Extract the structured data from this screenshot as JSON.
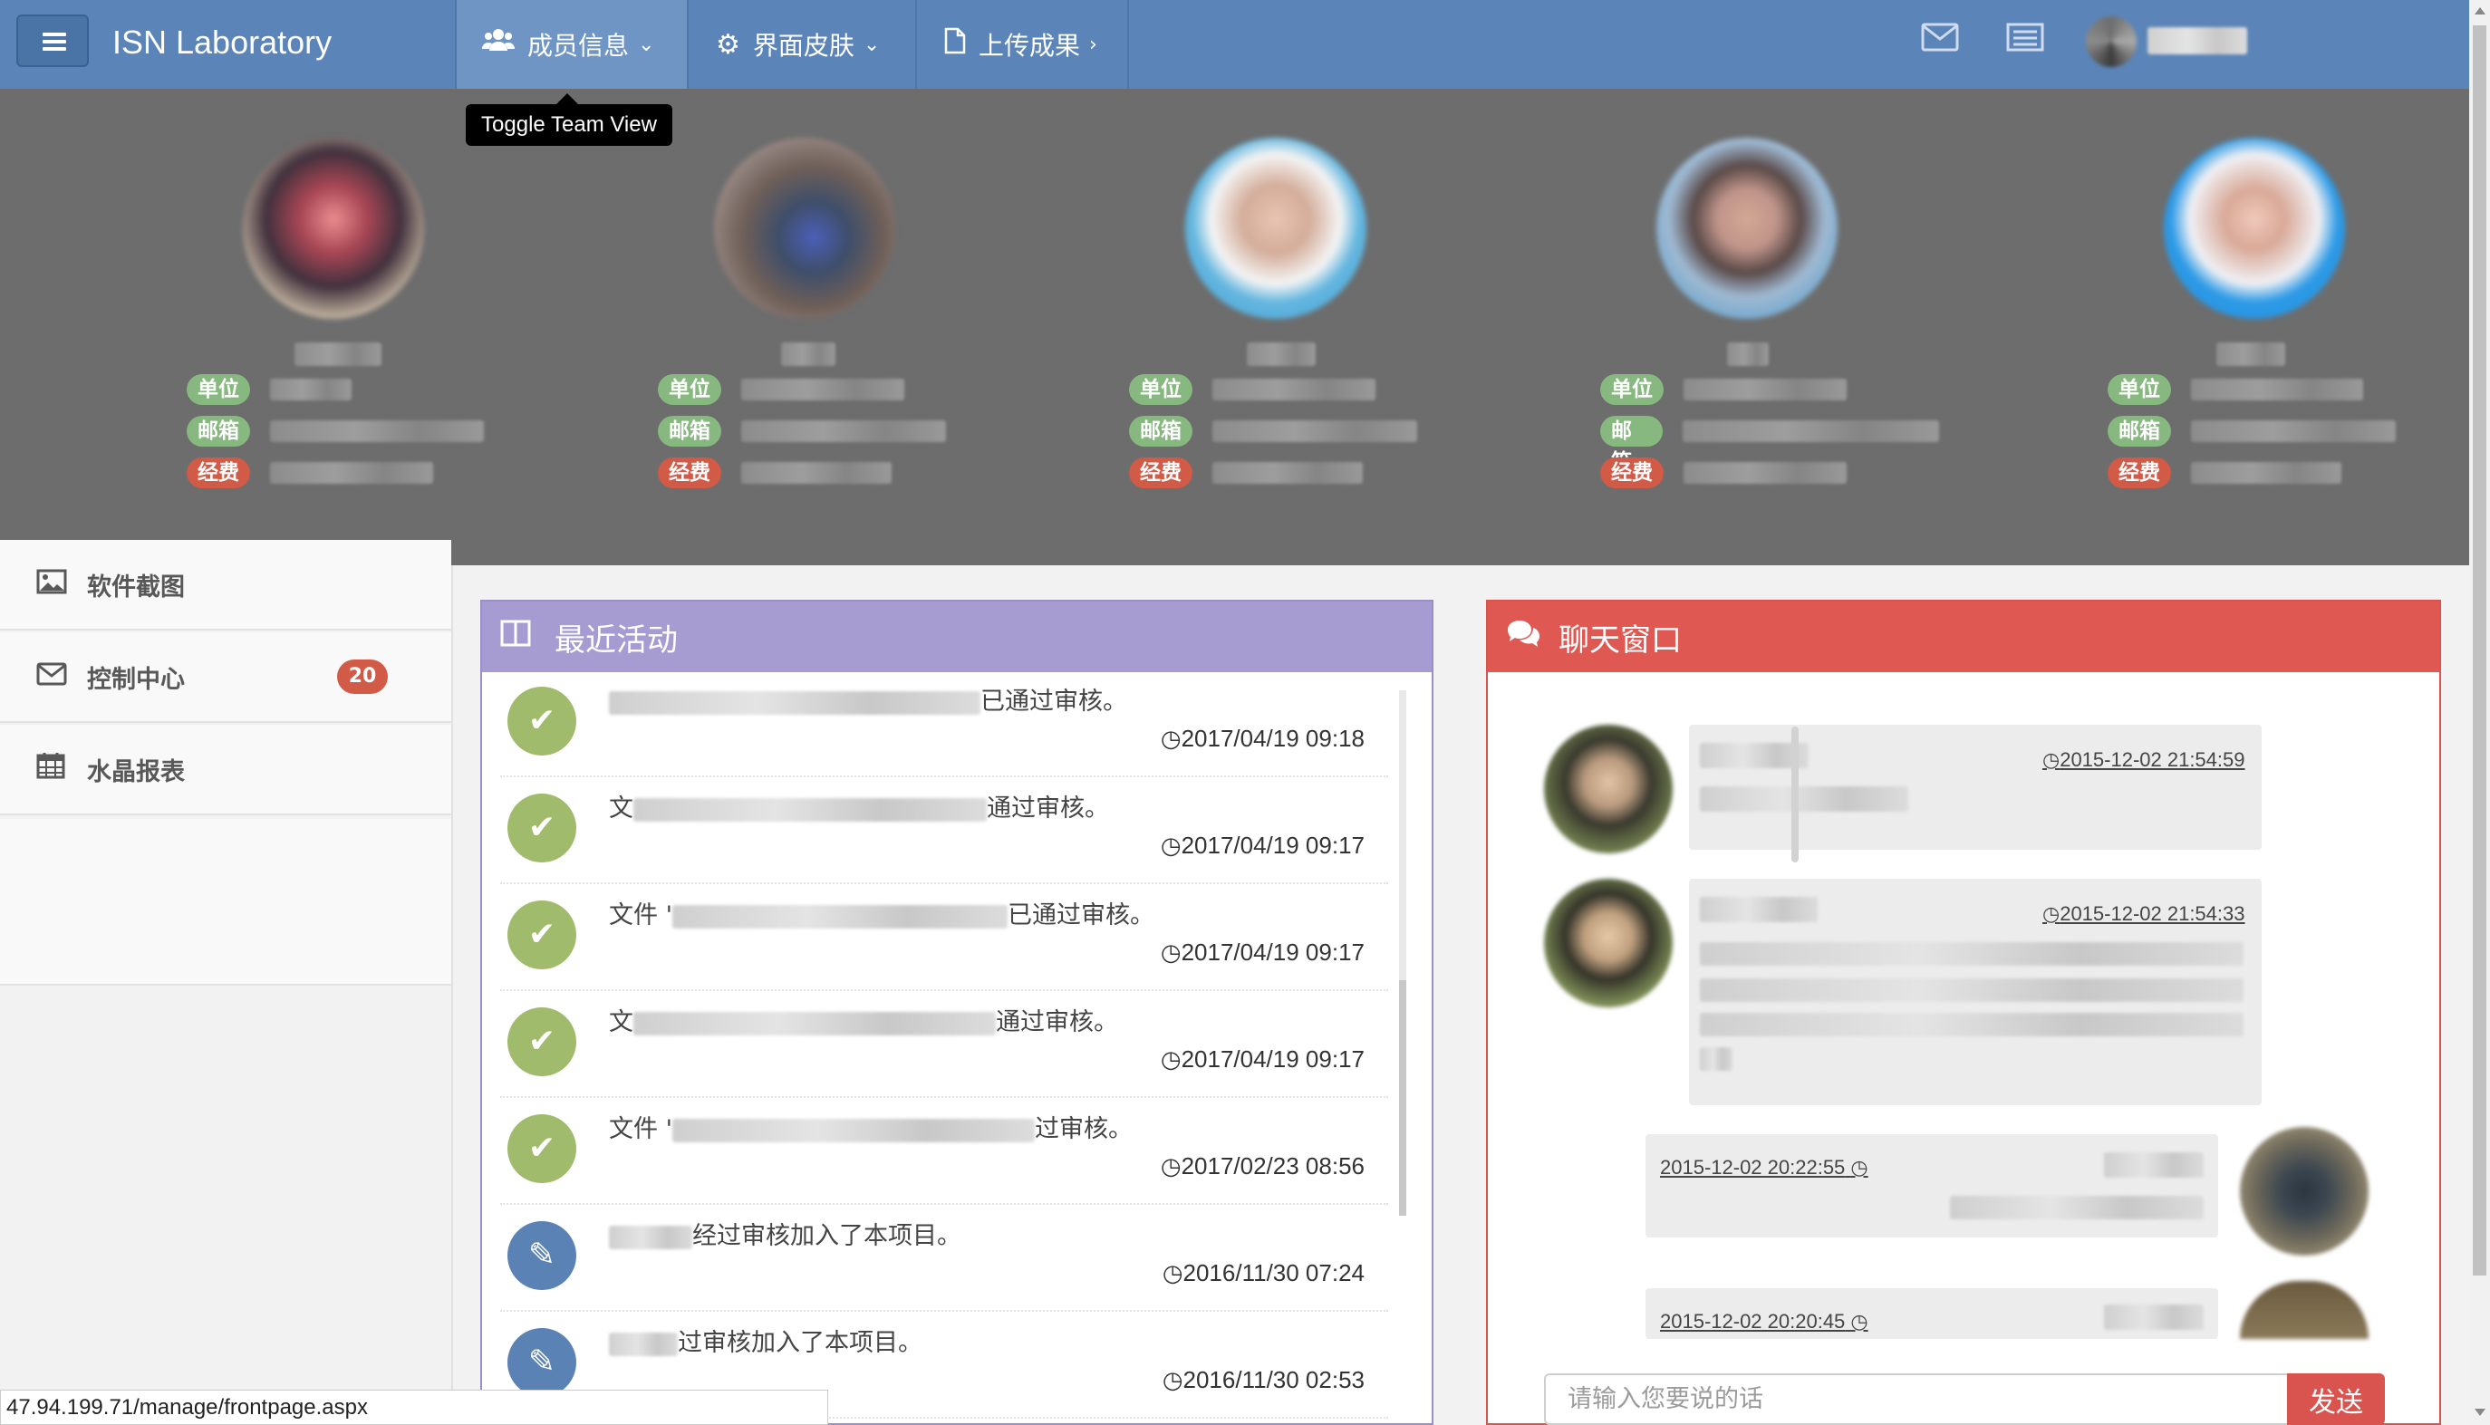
{
  "navbar": {
    "brand": "ISN Laboratory",
    "tabs": [
      {
        "label": "成员信息",
        "icon": "users-icon"
      },
      {
        "label": "界面皮肤",
        "icon": "gear-icon"
      },
      {
        "label": "上传成果",
        "icon": "file-icon"
      }
    ],
    "right_icons": [
      "mail-icon",
      "list-icon"
    ]
  },
  "tooltip": "Toggle Team View",
  "team": {
    "labels": {
      "unit": "单位",
      "email": "邮箱",
      "funding": "经费"
    },
    "colors": {
      "label_green": "#87b87f",
      "label_red": "#d15b47"
    }
  },
  "sidebar": {
    "items": [
      {
        "label": "软件截图",
        "icon": "image-icon"
      },
      {
        "label": "控制中心",
        "icon": "envelope-icon",
        "badge": "20"
      },
      {
        "label": "水晶报表",
        "icon": "calendar-icon"
      }
    ]
  },
  "activity": {
    "title": "最近活动",
    "items": [
      {
        "type": "check",
        "text": "已通过审核。",
        "prefix": "",
        "time": "2017/04/19 09:18"
      },
      {
        "type": "check",
        "text": "通过审核。",
        "prefix": "文",
        "time": "2017/04/19 09:17"
      },
      {
        "type": "check",
        "text": "已通过审核。",
        "prefix": "文件 '",
        "time": "2017/04/19 09:17"
      },
      {
        "type": "check",
        "text": "通过审核。",
        "prefix": "文",
        "time": "2017/04/19 09:17"
      },
      {
        "type": "check",
        "text": "过审核。",
        "prefix": "文件 '",
        "time": "2017/02/23 08:56"
      },
      {
        "type": "edit",
        "text": "经过审核加入了本项目。",
        "prefix": "",
        "time": "2016/11/30 07:24"
      },
      {
        "type": "edit",
        "text": "过审核加入了本项目。",
        "prefix": "",
        "time": "2016/11/30 02:53"
      }
    ]
  },
  "chat": {
    "title": "聊天窗口",
    "messages": [
      {
        "time": "2015-12-02 21:54:59"
      },
      {
        "time": "2015-12-02 21:54:33"
      },
      {
        "time": "2015-12-02 20:22:55"
      },
      {
        "time": "2015-12-02 20:20:45"
      }
    ],
    "input_placeholder": "请输入您要说的话",
    "send_label": "发送"
  },
  "status_url": "47.94.199.71/manage/frontpage.aspx"
}
